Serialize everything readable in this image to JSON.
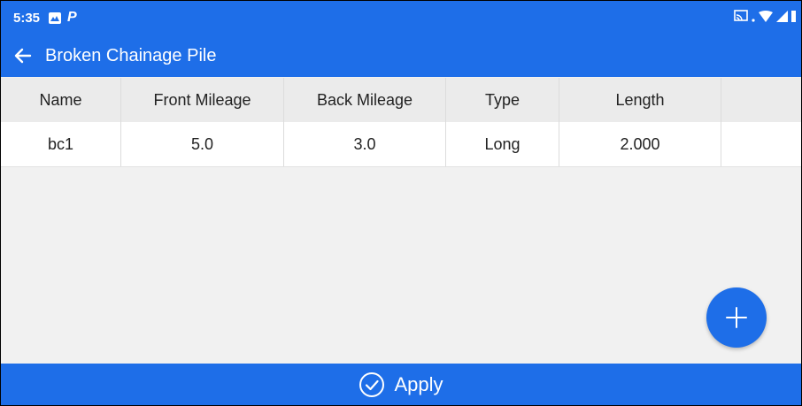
{
  "status_bar": {
    "time": "5:35",
    "icons": [
      "photos-icon",
      "parking-icon",
      "cast-icon",
      "wifi-icon",
      "signal-icon",
      "battery-icon"
    ]
  },
  "app_bar": {
    "title": "Broken Chainage Pile",
    "back_icon": "arrow-left-icon"
  },
  "table": {
    "columns": [
      "Name",
      "Front Mileage",
      "Back Mileage",
      "Type",
      "Length",
      ""
    ],
    "rows": [
      [
        "bc1",
        "5.0",
        "3.0",
        "Long",
        "2.000",
        ""
      ]
    ]
  },
  "fab": {
    "icon": "plus-icon"
  },
  "apply_button": {
    "label": "Apply",
    "icon": "check-circle-icon"
  },
  "colors": {
    "primary": "#1e6ee8",
    "header_bg": "#ebebeb",
    "body_bg": "#f1f1f1"
  }
}
